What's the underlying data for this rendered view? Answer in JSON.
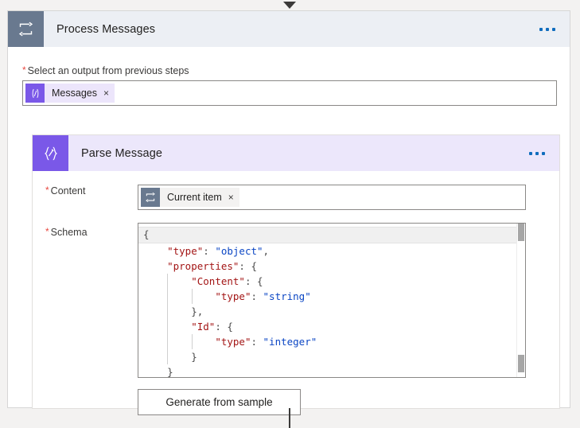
{
  "page": {
    "background_color": "#f3f2f1"
  },
  "connectors": {
    "top_arrow_icon": "chevron-down-arrowhead",
    "bottom_line": "vertical-connector-line"
  },
  "outer_card": {
    "icon": "loop-foreach-icon",
    "title": "Process Messages",
    "header_bg": "#eceff4",
    "icon_bg": "#69798f",
    "more_menu_label": "•••",
    "field": {
      "label": "Select an output from previous steps",
      "required": true,
      "required_marker": "*",
      "token": {
        "icon": "expression-icon",
        "icon_glyph": "(/)",
        "text": "Messages",
        "remove_label": "×",
        "icon_bg": "#7a58e8",
        "pill_bg": "#ece5fb"
      }
    }
  },
  "inner_card": {
    "icon": "parse-json-icon",
    "icon_glyph": "{∅}",
    "title": "Parse Message",
    "header_bg": "#ece7fb",
    "icon_bg": "#7a58e8",
    "more_menu_label": "•••",
    "content_field": {
      "label": "Content",
      "required": true,
      "required_marker": "*",
      "token": {
        "icon": "loop-current-item-icon",
        "text": "Current item",
        "remove_label": "×",
        "icon_bg": "#69798f",
        "pill_bg": "#f3f2f1"
      }
    },
    "schema_field": {
      "label": "Schema",
      "required": true,
      "required_marker": "*",
      "scrollbar": "vertical-scrollbar",
      "code_lines": [
        {
          "indent": 0,
          "active": true,
          "tokens": [
            {
              "t": "{",
              "c": "p"
            }
          ]
        },
        {
          "indent": 1,
          "active": false,
          "tokens": [
            {
              "t": "\"type\"",
              "c": "k"
            },
            {
              "t": ": ",
              "c": "p"
            },
            {
              "t": "\"object\"",
              "c": "v"
            },
            {
              "t": ",",
              "c": "p"
            }
          ]
        },
        {
          "indent": 1,
          "active": false,
          "tokens": [
            {
              "t": "\"properties\"",
              "c": "k"
            },
            {
              "t": ": {",
              "c": "p"
            }
          ]
        },
        {
          "indent": 2,
          "active": false,
          "tokens": [
            {
              "t": "\"Content\"",
              "c": "k"
            },
            {
              "t": ": {",
              "c": "p"
            }
          ]
        },
        {
          "indent": 3,
          "active": false,
          "tokens": [
            {
              "t": "\"type\"",
              "c": "k"
            },
            {
              "t": ": ",
              "c": "p"
            },
            {
              "t": "\"string\"",
              "c": "v"
            }
          ]
        },
        {
          "indent": 2,
          "active": false,
          "tokens": [
            {
              "t": "},",
              "c": "p"
            }
          ]
        },
        {
          "indent": 2,
          "active": false,
          "tokens": [
            {
              "t": "\"Id\"",
              "c": "k"
            },
            {
              "t": ": {",
              "c": "p"
            }
          ]
        },
        {
          "indent": 3,
          "active": false,
          "tokens": [
            {
              "t": "\"type\"",
              "c": "k"
            },
            {
              "t": ": ",
              "c": "p"
            },
            {
              "t": "\"integer\"",
              "c": "v"
            }
          ]
        },
        {
          "indent": 2,
          "active": false,
          "tokens": [
            {
              "t": "}",
              "c": "p"
            }
          ]
        },
        {
          "indent": 1,
          "active": false,
          "tokens": [
            {
              "t": "}",
              "c": "p"
            }
          ]
        }
      ],
      "raw_schema": "{\n    \"type\": \"object\",\n    \"properties\": {\n        \"Content\": {\n            \"type\": \"string\"\n        },\n        \"Id\": {\n            \"type\": \"integer\"\n        }\n    }\n}",
      "syntax_colors": {
        "key": "#a31515",
        "value": "#0b46c4",
        "punctuation": "#4a4a4a"
      }
    },
    "generate_button": {
      "label": "Generate from sample"
    }
  }
}
